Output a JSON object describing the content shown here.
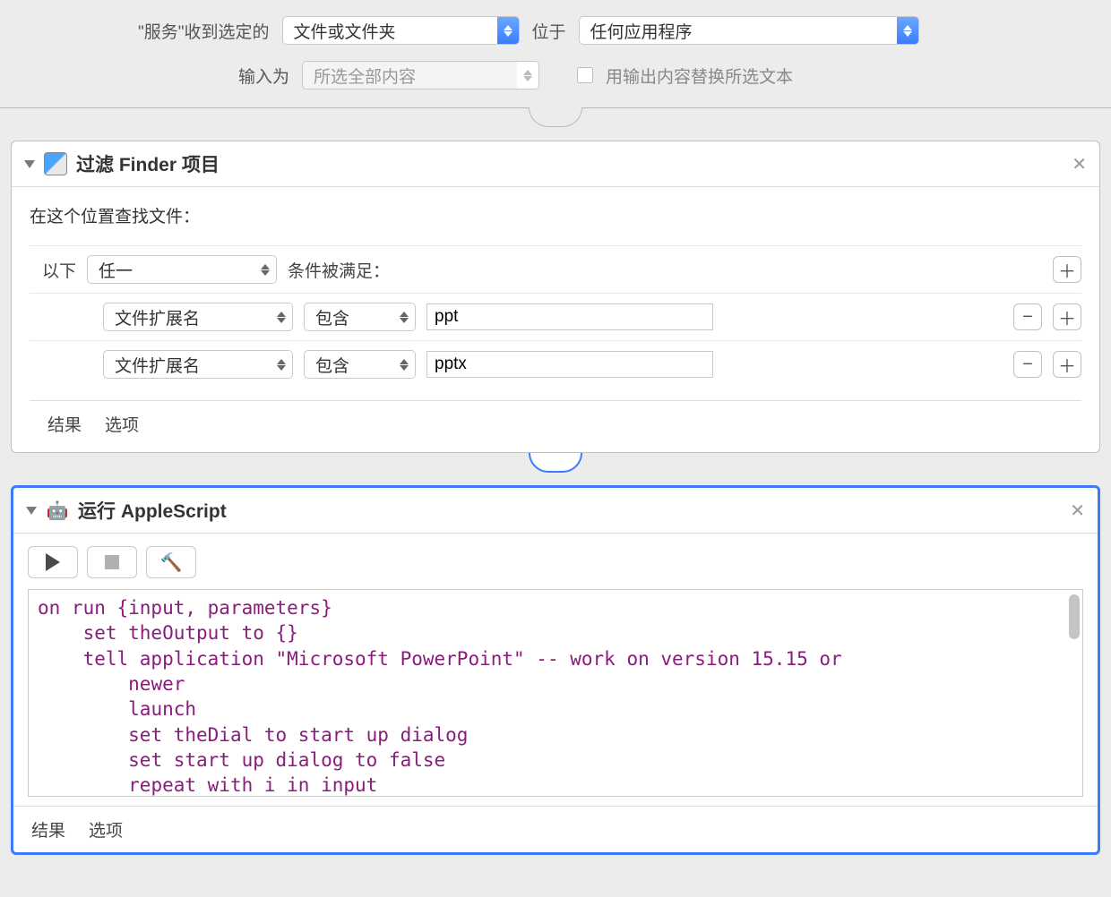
{
  "topbar": {
    "receives_label": "\"服务\"收到选定的",
    "receives_value": "文件或文件夹",
    "in_label": "位于",
    "in_value": "任何应用程序",
    "input_as_label": "输入为",
    "input_as_value": "所选全部内容",
    "replace_checkbox_label": "用输出内容替换所选文本"
  },
  "action1": {
    "title": "过滤 Finder 项目",
    "prompt": "在这个位置查找文件：",
    "match_prefix": "以下",
    "match_select": "任一",
    "match_suffix": "条件被满足：",
    "rules": [
      {
        "attr": "文件扩展名",
        "op": "包含",
        "value": "ppt"
      },
      {
        "attr": "文件扩展名",
        "op": "包含",
        "value": "pptx"
      }
    ],
    "footer": {
      "results": "结果",
      "options": "选项"
    }
  },
  "action2": {
    "title": "运行 AppleScript",
    "code": "on run {input, parameters}\n    set theOutput to {}\n    tell application \"Microsoft PowerPoint\" -- work on version 15.15 or\n        newer\n        launch\n        set theDial to start up dialog\n        set start up dialog to false\n        repeat with i in input\n            open i",
    "footer": {
      "results": "结果",
      "options": "选项"
    }
  }
}
